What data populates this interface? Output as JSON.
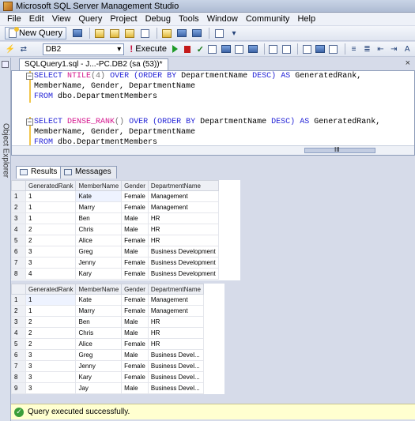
{
  "window": {
    "title": "Microsoft SQL Server Management Studio"
  },
  "menu": [
    "File",
    "Edit",
    "View",
    "Query",
    "Project",
    "Debug",
    "Tools",
    "Window",
    "Community",
    "Help"
  ],
  "toolbar": {
    "new_query_label": "New Query",
    "database": "DB2",
    "execute_label": "Execute"
  },
  "side_panel": {
    "label": "Object Explorer"
  },
  "document_tab": {
    "label": "SQLQuery1.sql - J...-PC.DB2 (sa (53))*",
    "close": "×"
  },
  "editor": {
    "query1": {
      "select": "SELECT",
      "func": "NTILE",
      "args": "(4)",
      "over": "OVER",
      "order": "(ORDER BY",
      "col": "DepartmentName",
      "desc": "DESC)",
      "as": "AS",
      "alias": "GeneratedRank,",
      "line2": "MemberName, Gender, DepartmentName",
      "from": "FROM",
      "table": "dbo.DepartmentMembers"
    },
    "query2": {
      "select": "SELECT",
      "func": "DENSE_RANK",
      "args": "()",
      "over": "OVER",
      "order": "(ORDER BY",
      "col": "DepartmentName",
      "desc": "DESC)",
      "as": "AS",
      "alias": "GeneratedRank,",
      "line2": "MemberName, Gender, DepartmentName",
      "from": "FROM",
      "table": "dbo.DepartmentMembers"
    },
    "scroll_marker": "III"
  },
  "results_tabs": {
    "results": "Results",
    "messages": "Messages"
  },
  "grid1": {
    "columns": [
      "GeneratedRank",
      "MemberName",
      "Gender",
      "DepartmentName"
    ],
    "rows": [
      [
        "1",
        "1",
        "Kate",
        "Female",
        "Management"
      ],
      [
        "2",
        "1",
        "Marry",
        "Female",
        "Management"
      ],
      [
        "3",
        "1",
        "Ben",
        "Male",
        "HR"
      ],
      [
        "4",
        "2",
        "Chris",
        "Male",
        "HR"
      ],
      [
        "5",
        "2",
        "Alice",
        "Female",
        "HR"
      ],
      [
        "6",
        "3",
        "Greg",
        "Male",
        "Business Development"
      ],
      [
        "7",
        "3",
        "Jenny",
        "Female",
        "Business Development"
      ],
      [
        "8",
        "4",
        "Kary",
        "Female",
        "Business Development"
      ]
    ]
  },
  "grid2": {
    "columns": [
      "GeneratedRank",
      "MemberName",
      "Gender",
      "DepartmentName"
    ],
    "rows": [
      [
        "1",
        "1",
        "Kate",
        "Female",
        "Management"
      ],
      [
        "2",
        "1",
        "Marry",
        "Female",
        "Management"
      ],
      [
        "3",
        "2",
        "Ben",
        "Male",
        "HR"
      ],
      [
        "4",
        "2",
        "Chris",
        "Male",
        "HR"
      ],
      [
        "5",
        "2",
        "Alice",
        "Female",
        "HR"
      ],
      [
        "6",
        "3",
        "Greg",
        "Male",
        "Business Devel..."
      ],
      [
        "7",
        "3",
        "Jenny",
        "Female",
        "Business Devel..."
      ],
      [
        "8",
        "3",
        "Kary",
        "Female",
        "Business Devel..."
      ],
      [
        "9",
        "3",
        "Jay",
        "Male",
        "Business Devel..."
      ]
    ]
  },
  "status": {
    "text": "Query executed successfully."
  }
}
